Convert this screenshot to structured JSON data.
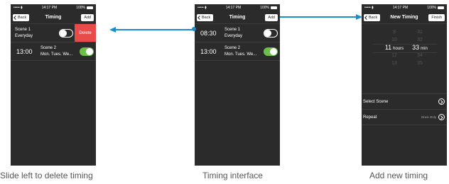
{
  "status": {
    "carrier": "••••• ⧫",
    "time": "14:17 PM",
    "battery": "100%"
  },
  "left_screen": {
    "back": "Back",
    "title": "Timing",
    "add": "Add",
    "rows": [
      {
        "time": "",
        "scene": "Scene 1",
        "days": "Everyday",
        "on": false,
        "delete": "Delete"
      },
      {
        "time": "13:00",
        "scene": "Scene 2",
        "days": "Mon. Tues. We...",
        "on": true
      }
    ]
  },
  "mid_screen": {
    "back": "Back",
    "title": "Timing",
    "add": "Add",
    "rows": [
      {
        "time": "08:30",
        "scene": "Scene 1",
        "days": "Everyday",
        "on": false
      },
      {
        "time": "13:00",
        "scene": "Scene 2",
        "days": "Mon. Tues. We...",
        "on": true
      }
    ]
  },
  "right_screen": {
    "back": "Back",
    "title": "New Timing",
    "finish": "Finish",
    "hours": [
      "9",
      "10",
      "11",
      "12",
      "13"
    ],
    "hours_unit": "hours",
    "minutes": [
      "31",
      "32",
      "33",
      "34",
      "35"
    ],
    "minutes_unit": "min",
    "select_scene": "Select Scene",
    "repeat": "Repeat",
    "repeat_value": "Once Only"
  },
  "captions": {
    "left": "Slide left to delete timing",
    "mid": "Timing interface",
    "right": "Add new timing"
  },
  "colors": {
    "arrow": "#1a8fd0",
    "toggle_on": "#6cc04a",
    "delete": "#e94b4b"
  }
}
